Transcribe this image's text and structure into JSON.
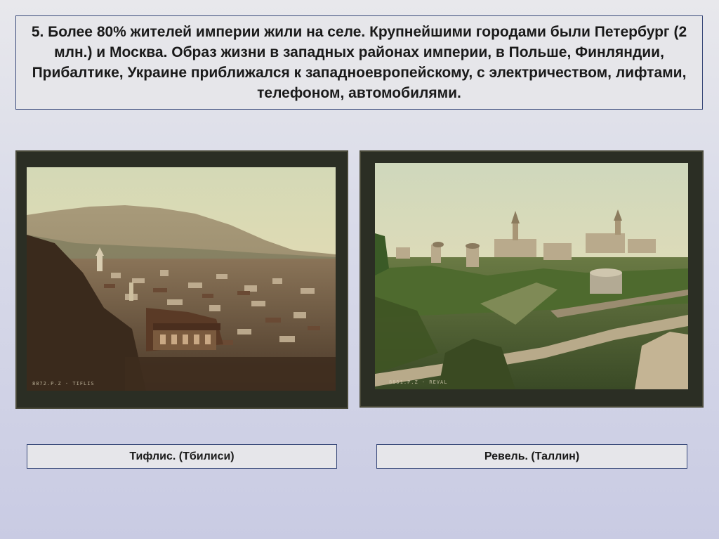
{
  "slide": {
    "text": "5. Более 80% жителей империи жили на селе. Крупнейшими городами были Петербург (2 млн.) и Москва. Образ жизни в западных районах империи, в Польше, Финляндии, Прибалтике, Украине приближался к западноевропейскому, с электричеством, лифтами, телефоном, автомобилями."
  },
  "photos": [
    {
      "caption": "Тифлис. (Тбилиси)",
      "imprint": "8872.P.Z · TIFLIS"
    },
    {
      "caption": "Ревель. (Таллин)",
      "imprint": "8851.P.Z · REVAL"
    }
  ],
  "colors": {
    "border": "#3a4a7a",
    "box_fill": "#e6e6ea",
    "frame": "#2b2e24"
  }
}
